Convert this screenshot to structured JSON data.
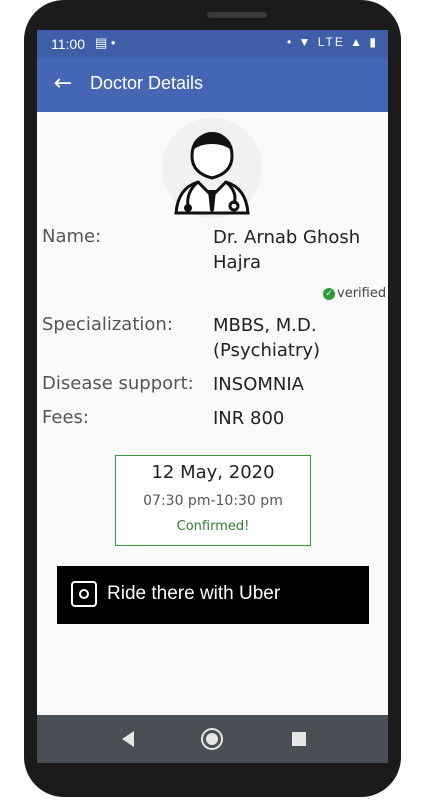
{
  "status_bar": {
    "time": "11:00",
    "notification_icons": "▤ •",
    "right_icons": "• ▼ LTE ▲ ▮"
  },
  "app_bar": {
    "back_icon": "←",
    "title": "Doctor Details"
  },
  "doctor": {
    "name_label": "Name:",
    "name_line1": "Dr. Arnab Ghosh",
    "name_line2": "Hajra",
    "verified_label": "verified",
    "specialization_label": "Specialization:",
    "specialization_line1": "MBBS, M.D.",
    "specialization_line2": "(Psychiatry)",
    "disease_label": "Disease support:",
    "disease_value": "INSOMNIA",
    "fees_label": "Fees:",
    "fees_value": "INR 800"
  },
  "appointment": {
    "date": "12 May, 2020",
    "time": "07:30 pm-10:30 pm",
    "status": "Confirmed!"
  },
  "uber_button": {
    "label": "Ride there with Uber"
  },
  "colors": {
    "status_bar": "#3f5ea8",
    "app_bar": "#4566b4",
    "confirmed": "#2e7d32",
    "verified_check": "#2e9c3a"
  },
  "icons": [
    "back-arrow-icon",
    "doctor-avatar-icon",
    "verified-check-icon",
    "uber-logo-icon",
    "nav-back-icon",
    "nav-home-icon",
    "nav-recent-icon"
  ]
}
